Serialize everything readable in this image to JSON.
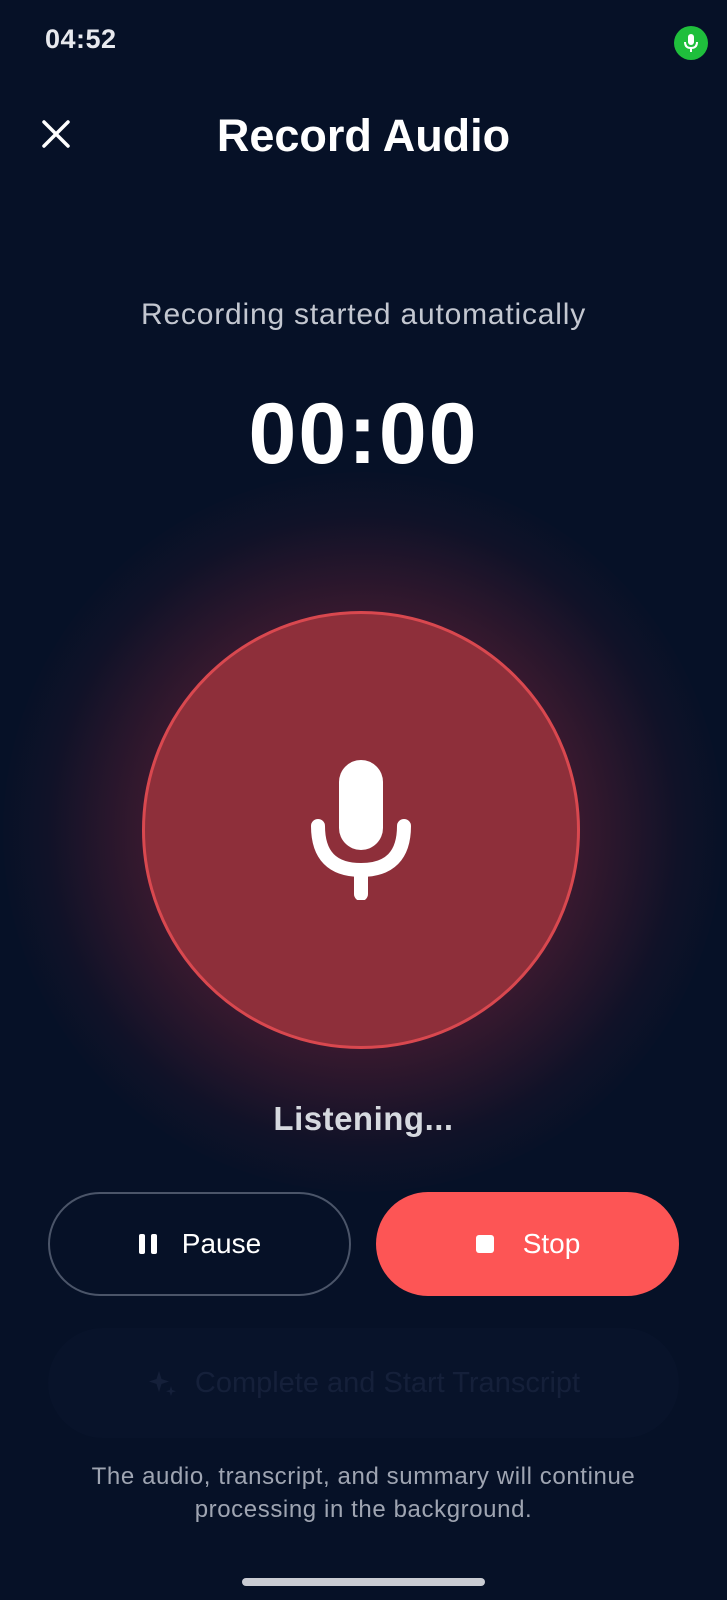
{
  "status_bar": {
    "time": "04:52",
    "indicator_icon": "microphone-icon",
    "indicator_color": "#1fbf3c"
  },
  "header": {
    "title": "Record Audio",
    "close_icon": "close-icon"
  },
  "recording": {
    "status_text": "Recording started automatically",
    "timer": "00:00",
    "state_text": "Listening...",
    "button_icon": "microphone-icon",
    "circle_color": "#8e2f3a",
    "ring_color": "#d9484f"
  },
  "controls": {
    "pause_label": "Pause",
    "pause_icon": "pause-icon",
    "stop_label": "Stop",
    "stop_icon": "stop-icon",
    "stop_color": "#fd5555"
  },
  "complete_button": {
    "label": "Complete and Start Transcript",
    "icon": "sparkle-icon",
    "enabled": false
  },
  "footnote": "The audio, transcript, and summary will continue processing in the background."
}
